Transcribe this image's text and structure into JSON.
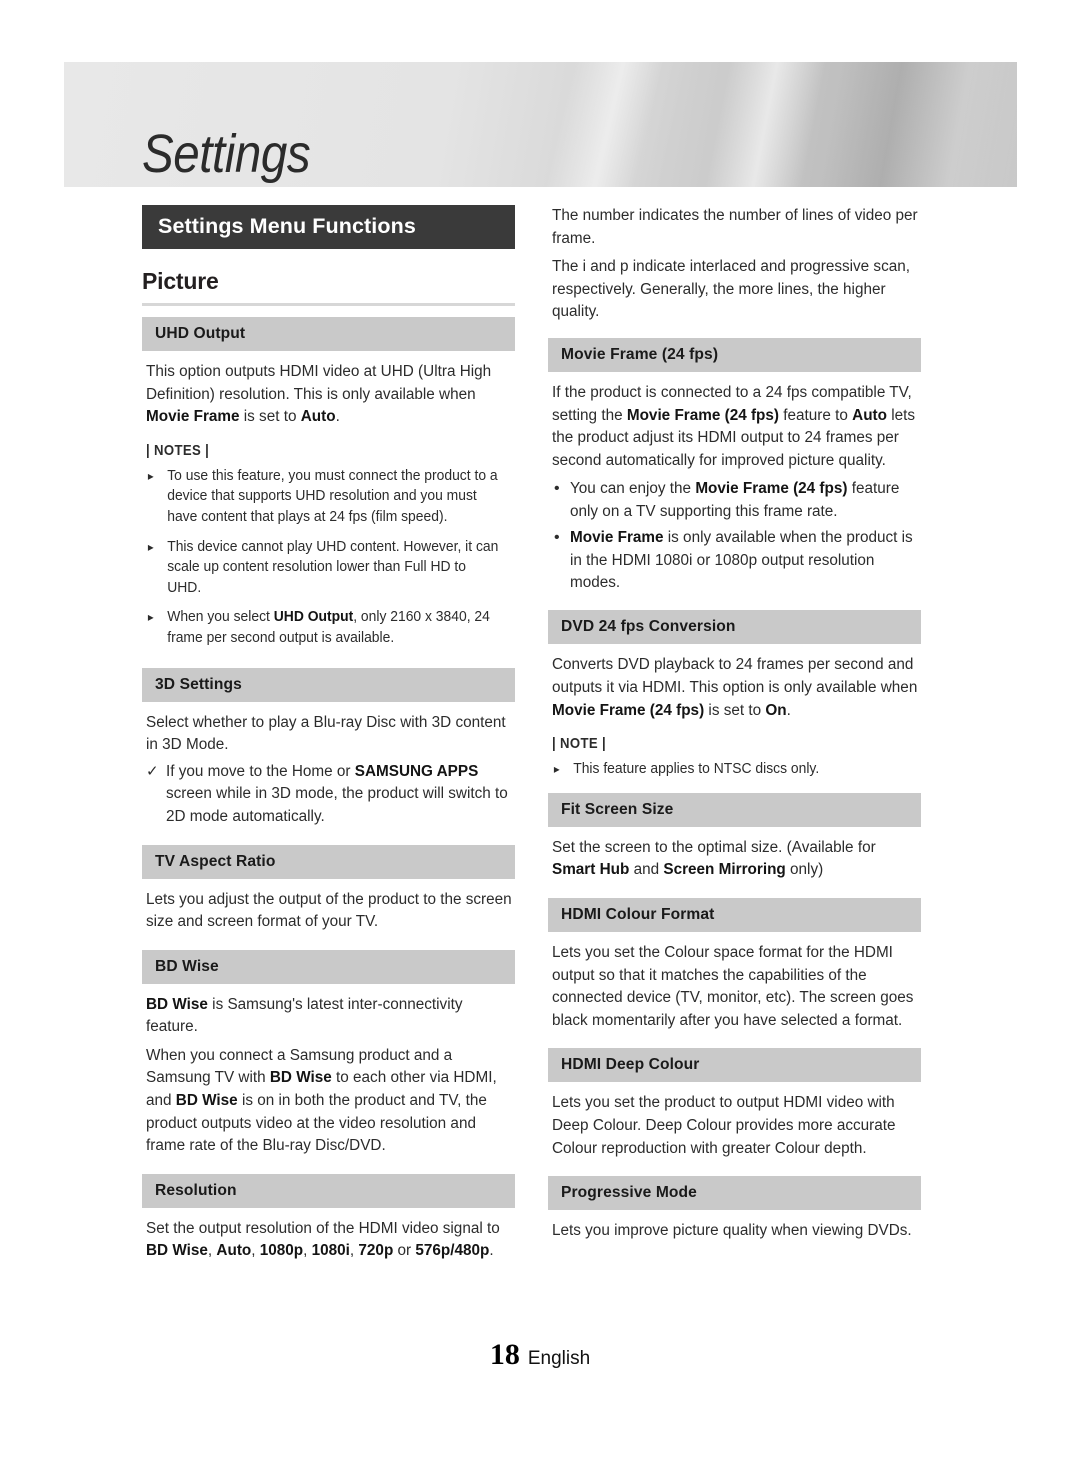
{
  "banner": {
    "title": "Settings"
  },
  "section": {
    "bar_title": "Settings Menu Functions",
    "group_heading": "Picture"
  },
  "left_column": {
    "uhd_output": {
      "heading": "UHD Output",
      "body_1": "This option outputs HDMI video at UHD (Ultra High Definition) resolution. This is only available when ",
      "body_bold_1": "Movie Frame",
      "body_2": " is set to ",
      "body_bold_2": "Auto",
      "body_3": ".",
      "notes_label": "| NOTES |",
      "notes": [
        {
          "marker": "▸",
          "text": "To use this feature, you must connect the product to a device that supports UHD resolution and you must have content that plays at 24 fps (film speed)."
        },
        {
          "marker": "▸",
          "text": "This device cannot play UHD content. However, it can scale up content resolution lower than Full HD to UHD."
        },
        {
          "marker": "▸",
          "pre": "When you select ",
          "bold": "UHD Output",
          "post": ", only 2160 x 3840, 24 frame per second output is available."
        }
      ]
    },
    "three_d_settings": {
      "heading": "3D Settings",
      "body": "Select whether to play a Blu-ray Disc with 3D content in 3D Mode.",
      "check": {
        "marker": "✓",
        "pre": "If you move to the Home or ",
        "bold": "SAMSUNG APPS",
        "post": " screen while in 3D mode, the product will switch to 2D mode automatically."
      }
    },
    "tv_aspect_ratio": {
      "heading": "TV Aspect Ratio",
      "body": "Lets you adjust the output of the product to the screen size and screen format of your TV."
    },
    "bd_wise": {
      "heading": "BD Wise",
      "p1_bold": "BD Wise",
      "p1_rest": " is Samsung's latest inter-connectivity feature.",
      "p2_a": "When you connect a Samsung product and a Samsung TV with ",
      "p2_b1": "BD Wise",
      "p2_c": " to each other via HDMI, and ",
      "p2_b2": "BD Wise",
      "p2_d": " is on in both the product and TV, the product outputs video at the video resolution and frame rate of the Blu-ray Disc/DVD."
    },
    "resolution": {
      "heading": "Resolution",
      "pre": "Set the output resolution of the HDMI video signal to ",
      "opt_1": "BD Wise",
      "sep_1": ", ",
      "opt_2": "Auto",
      "sep_2": ", ",
      "opt_3": "1080p",
      "sep_3": ", ",
      "opt_4": "1080i",
      "sep_4": ", ",
      "opt_5": "720p",
      "sep_5": " or ",
      "opt_6": "576p/480p",
      "post": "."
    }
  },
  "right_column": {
    "resolution_cont": {
      "p1": "The number indicates the number of lines of video per frame.",
      "p2": "The i and p indicate interlaced and progressive scan, respectively. Generally, the more lines, the higher quality."
    },
    "movie_frame": {
      "heading": "Movie Frame (24 fps)",
      "p_a": "If the product is connected to a 24 fps compatible TV, setting the ",
      "p_b": "Movie Frame (24 fps)",
      "p_c": " feature to ",
      "p_d": "Auto",
      "p_e": " lets the product adjust its HDMI output to 24 frames per second automatically for improved picture quality.",
      "bullets": [
        {
          "marker": "•",
          "pre": "You can enjoy the ",
          "bold": "Movie Frame (24 fps)",
          "post": " feature only on a TV supporting this frame rate."
        },
        {
          "marker": "•",
          "pre": "",
          "bold": "Movie Frame",
          "post": " is only available when the product is in the HDMI 1080i or 1080p output resolution modes."
        }
      ]
    },
    "dvd_24fps": {
      "heading": "DVD 24 fps Conversion",
      "p_a": "Converts DVD playback to 24 frames per second and outputs it via HDMI. This option is only available when ",
      "p_b": "Movie Frame (24 fps)",
      "p_c": " is set to ",
      "p_d": "On",
      "p_e": ".",
      "note_label": "| NOTE |",
      "notes": [
        {
          "marker": "▸",
          "text": "This feature applies to NTSC discs only."
        }
      ]
    },
    "fit_screen_size": {
      "heading": "Fit Screen Size",
      "p_a": "Set the screen to the optimal size. (Available for ",
      "p_b": "Smart Hub",
      "p_c": " and ",
      "p_d": "Screen Mirroring",
      "p_e": " only)"
    },
    "hdmi_colour_format": {
      "heading": "HDMI Colour Format",
      "body": "Lets you set the Colour space format for the HDMI output so that it matches the capabilities of the connected device (TV, monitor, etc). The screen goes black momentarily after you have selected a format."
    },
    "hdmi_deep_colour": {
      "heading": "HDMI Deep Colour",
      "body": "Lets you set the product to output HDMI video with Deep Colour. Deep Colour provides more accurate Colour reproduction with greater Colour depth."
    },
    "progressive_mode": {
      "heading": "Progressive Mode",
      "body": "Lets you improve picture quality when viewing DVDs."
    }
  },
  "footer": {
    "page_number": "18",
    "language": "English"
  },
  "colors": {
    "section_bar_bg": "#3a3a3a",
    "item_head_bg": "#c9c9c9",
    "text": "#2c2c2c",
    "rule": "#d7d7d7"
  }
}
